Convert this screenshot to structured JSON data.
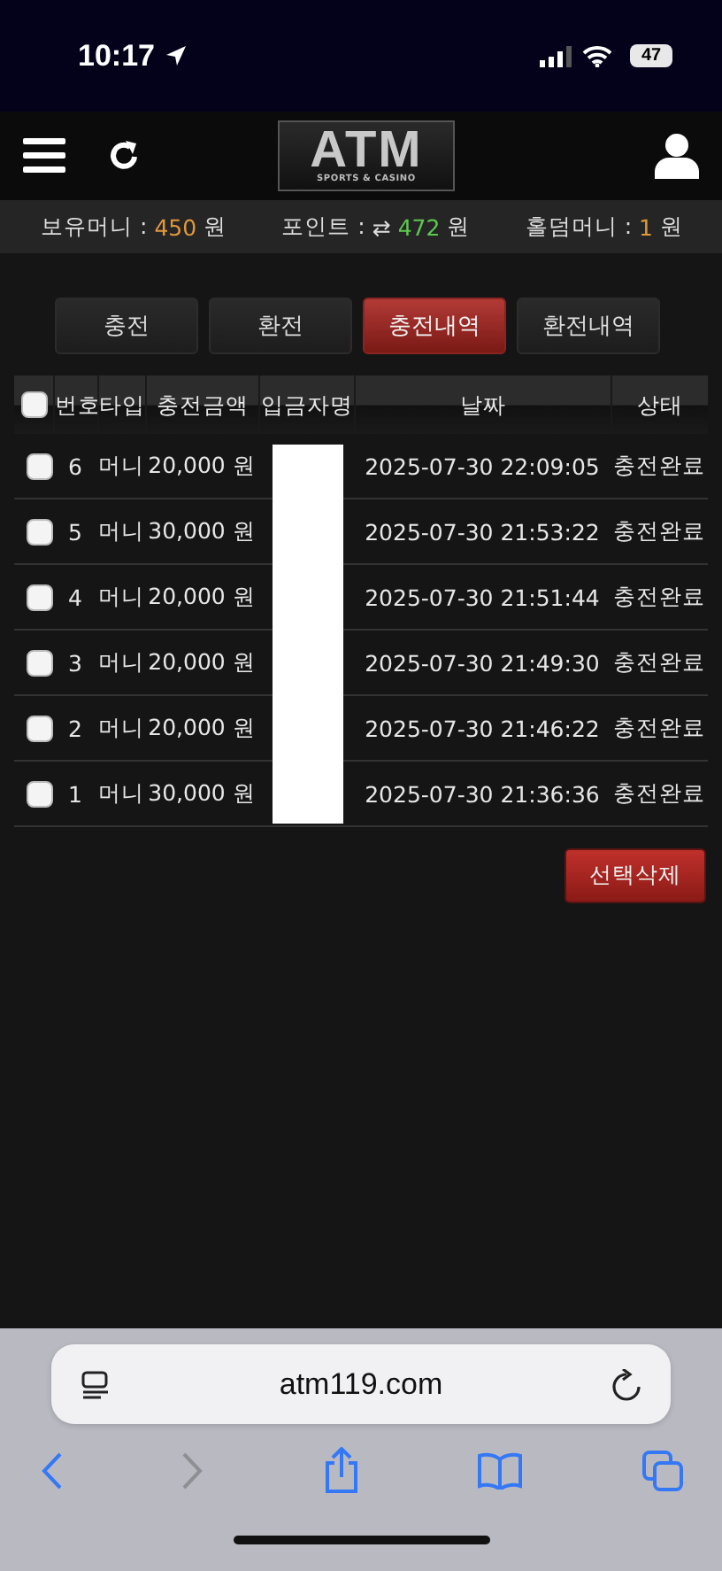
{
  "status_bar": {
    "time": "10:17",
    "battery": "47"
  },
  "header": {
    "logo": "ATM",
    "logo_subtitle": "SPORTS & CASINO"
  },
  "balance_bar": [
    {
      "label": "보유머니 :",
      "value": "450",
      "unit": "원",
      "color": "#e0983a"
    },
    {
      "label": "포인트 :",
      "prefix": "⇄",
      "value": "472",
      "unit": "원",
      "color": "#5cc94e"
    },
    {
      "label": "홀덤머니 :",
      "value": "1",
      "unit": "원",
      "color": "#e0983a"
    }
  ],
  "tabs": [
    {
      "label": "충전",
      "selected": false
    },
    {
      "label": "환전",
      "selected": false
    },
    {
      "label": "충전내역",
      "selected": true
    },
    {
      "label": "환전내역",
      "selected": false
    }
  ],
  "table": {
    "select_all": {
      "checked": false
    },
    "columns": [
      "번호",
      "타입",
      "충전금액",
      "입금자명",
      "날짜",
      "상태"
    ],
    "rows": [
      {
        "checked": false,
        "number": "6",
        "type": "머니",
        "amount": "20,000 원",
        "date": "2025-07-30 22:09:05",
        "status": "충전완료"
      },
      {
        "checked": false,
        "number": "5",
        "type": "머니",
        "amount": "30,000 원",
        "date": "2025-07-30 21:53:22",
        "status": "충전완료"
      },
      {
        "checked": false,
        "number": "4",
        "type": "머니",
        "amount": "20,000 원",
        "date": "2025-07-30 21:51:44",
        "status": "충전완료"
      },
      {
        "checked": false,
        "number": "3",
        "type": "머니",
        "amount": "20,000 원",
        "date": "2025-07-30 21:49:30",
        "status": "충전완료"
      },
      {
        "checked": false,
        "number": "2",
        "type": "머니",
        "amount": "20,000 원",
        "date": "2025-07-30 21:46:22",
        "status": "충전완료"
      },
      {
        "checked": false,
        "number": "1",
        "type": "머니",
        "amount": "30,000 원",
        "date": "2025-07-30 21:36:36",
        "status": "충전완료"
      }
    ]
  },
  "delete_button": "선택삭제",
  "browser": {
    "url": "atm119.com"
  }
}
